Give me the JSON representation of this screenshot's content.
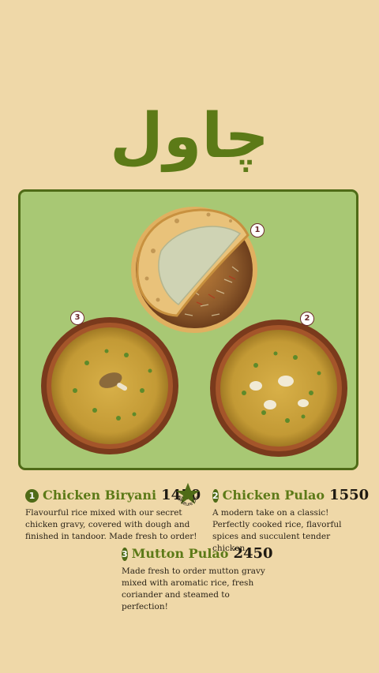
{
  "title": "چاول",
  "colors": {
    "background": "#efd8a8",
    "accent": "#5c7a17",
    "panel": "#a8c874",
    "badge_text": "#6b2a2a"
  },
  "dish_badges": [
    "1",
    "2",
    "3"
  ],
  "items": [
    {
      "number": "1",
      "name": "Chicken Biryani",
      "price": "1450",
      "description": "Flavourful rice mixed with our secret chicken gravy, covered with dough and finished in tandoor. Made fresh to order!"
    },
    {
      "number": "2",
      "name": "Chicken Pulao",
      "price": "1550",
      "description": "A modern take on a classic! Perfectly cooked rice, flavorful spices and succulent tender chicken."
    },
    {
      "number": "3",
      "name": "Mutton Pulao",
      "price": "2450",
      "description": "Made fresh to order mutton gravy mixed with aromatic rice, fresh coriander and steamed to perfection!"
    }
  ],
  "signature_badge": {
    "text": "Signature Dish",
    "icon": "star-icon"
  }
}
